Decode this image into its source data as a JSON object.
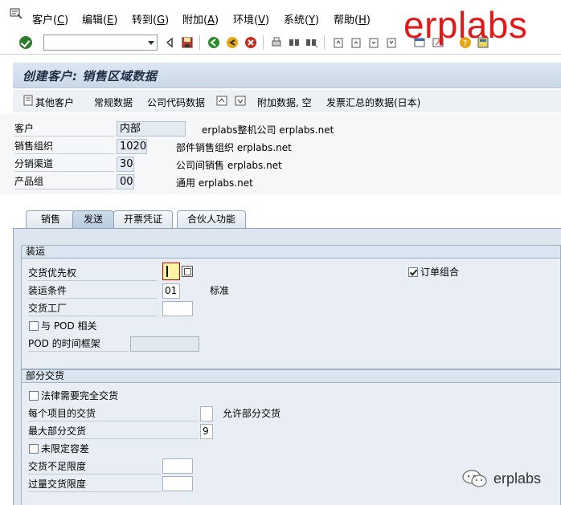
{
  "menu": {
    "items": [
      {
        "label": "客户",
        "accel": "C"
      },
      {
        "label": "编辑",
        "accel": "E"
      },
      {
        "label": "转到",
        "accel": "G"
      },
      {
        "label": "附加",
        "accel": "A"
      },
      {
        "label": "环境",
        "accel": "V"
      },
      {
        "label": "系统",
        "accel": "Y"
      },
      {
        "label": "帮助",
        "accel": "H"
      }
    ]
  },
  "watermark": {
    "top": "erplabs",
    "bottom": "erplabs"
  },
  "toolbar": {
    "command_value": "",
    "icons": [
      "enter-icon",
      "back-nav-icon",
      "save-icon",
      "back-icon",
      "exit-icon",
      "cancel-icon",
      "print-icon",
      "find-icon",
      "find-next-icon",
      "first-page-icon",
      "previous-page-icon",
      "next-page-icon",
      "last-page-icon",
      "new-session-icon",
      "shortcut-icon",
      "help-icon",
      "layout-icon"
    ]
  },
  "title": "创建客户: 销售区域数据",
  "app_toolbar": {
    "other_customer": "其他客户",
    "general_data": "常规数据",
    "company_code_data": "公司代码数据",
    "additional_data": "附加数据, 空",
    "billing_summary": "发票汇总的数据(日本)"
  },
  "header": {
    "rows": [
      {
        "label": "客户",
        "value": "内部",
        "desc": "erplabs整机公司 erplabs.net"
      },
      {
        "label": "销售组织",
        "value": "1020",
        "desc": "部件销售组织 erplabs.net"
      },
      {
        "label": "分销渠道",
        "value": "30",
        "desc": "公司间销售 erplabs.net"
      },
      {
        "label": "产品组",
        "value": "00",
        "desc": "通用 erplabs.net"
      }
    ]
  },
  "tabs": [
    {
      "label": "销售",
      "active": false
    },
    {
      "label": "发送",
      "active": true
    },
    {
      "label": "开票凭证",
      "active": false
    },
    {
      "label": "合伙人功能",
      "active": false
    }
  ],
  "shipping": {
    "title": "装运",
    "delivery_priority_label": "交货优先权",
    "delivery_priority_value": "",
    "order_combination_label": "订单组合",
    "order_combination_checked": true,
    "shipping_conditions_label": "装运条件",
    "shipping_conditions_value": "01",
    "shipping_conditions_desc": "标准",
    "delivering_plant_label": "交货工厂",
    "delivering_plant_value": "",
    "pod_relevant_label": "与 POD 相关",
    "pod_relevant_checked": false,
    "pod_timeframe_label": "POD 的时间框架",
    "pod_timeframe_value": ""
  },
  "partial_delivery": {
    "title": "部分交货",
    "complete_delivery_label": "法律需要完全交货",
    "complete_delivery_checked": false,
    "partial_per_item_label": "每个项目的交货",
    "partial_per_item_value": "",
    "partial_per_item_desc": "允许部分交货",
    "max_partial_label": "最大部分交货",
    "max_partial_value": "9",
    "unlimited_tolerance_label": "未限定容差",
    "unlimited_tolerance_checked": false,
    "underdelivery_label": "交货不足限度",
    "underdelivery_value": "",
    "overdelivery_label": "过量交货限度",
    "overdelivery_value": ""
  }
}
